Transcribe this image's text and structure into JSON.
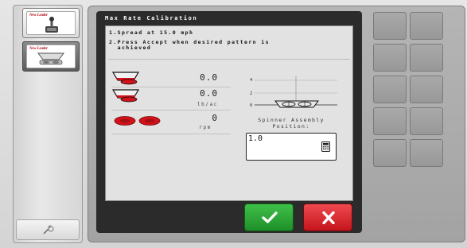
{
  "app": {
    "brand_1": "New Leader",
    "brand_2": "New Leader"
  },
  "dialog": {
    "title": "Max Rate Calibration",
    "instructions": [
      "1.Spread at 15.0 mph",
      "2.Press Accept when desired pattern is",
      "  achieved"
    ],
    "bin_1_value": "0.0",
    "bin_2_value": "0.0",
    "rate_unit": "lb/ac",
    "spinner_value": "0",
    "spinner_unit": "rpm",
    "gauge_labels": [
      "4",
      "2",
      "0"
    ],
    "spinner_position_caption_1": "Spinner Assembly",
    "spinner_position_caption_2": "Position:",
    "spinner_position_value": "1.0"
  },
  "icons": {
    "bin": "hopper-icon",
    "spinners": "spinner-discs-icon",
    "calculator": "calculator-icon",
    "accept": "checkmark-icon",
    "cancel": "x-icon",
    "settings": "wrench-icon",
    "joystick": "joystick-icon"
  },
  "colors": {
    "accept": "#2ea83a",
    "cancel": "#d92128",
    "spinner_red": "#d0121a",
    "frame": "#2b2b2b"
  }
}
